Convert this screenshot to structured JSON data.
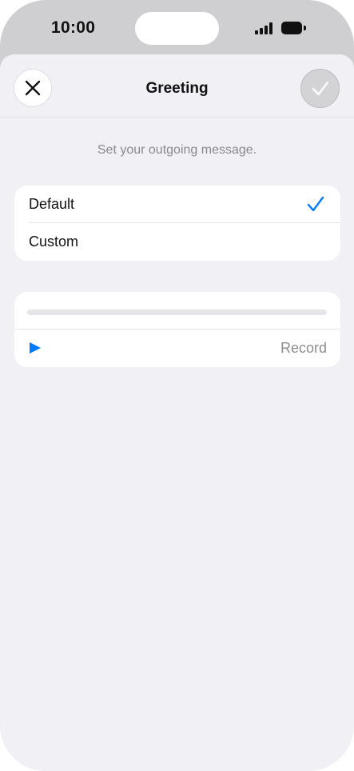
{
  "status_bar": {
    "time": "10:00"
  },
  "nav": {
    "title": "Greeting",
    "close_icon": "close-x-icon",
    "done_icon": "checkmark-icon"
  },
  "subtitle": "Set your outgoing message.",
  "options": [
    {
      "label": "Default",
      "selected": true
    },
    {
      "label": "Custom",
      "selected": false
    }
  ],
  "recording": {
    "progress": 0,
    "play_icon": "play-icon",
    "record_label": "Record"
  },
  "colors": {
    "accent": "#007aff",
    "sheet_background": "#f0f0f5",
    "card_background": "#ffffff",
    "secondary_text": "#8a8a8e"
  }
}
